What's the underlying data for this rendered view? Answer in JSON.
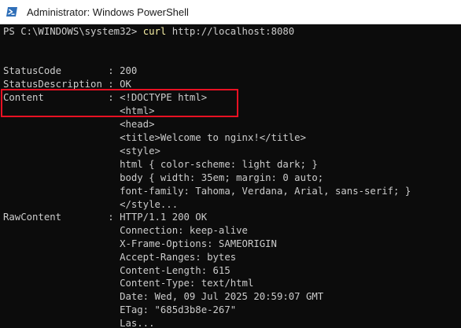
{
  "window": {
    "title": "Administrator: Windows PowerShell",
    "icon": "powershell-icon"
  },
  "terminal": {
    "prompt": "PS C:\\WINDOWS\\system32> ",
    "command": "curl",
    "command_args": " http://localhost:8080",
    "lines": [
      "StatusCode        : 200",
      "StatusDescription : OK",
      "Content           : <!DOCTYPE html>",
      "                    <html>",
      "                    <head>",
      "                    <title>Welcome to nginx!</title>",
      "                    <style>",
      "                    html { color-scheme: light dark; }",
      "                    body { width: 35em; margin: 0 auto;",
      "                    font-family: Tahoma, Verdana, Arial, sans-serif; }",
      "                    </style...",
      "RawContent        : HTTP/1.1 200 OK",
      "                    Connection: keep-alive",
      "                    X-Frame-Options: SAMEORIGIN",
      "                    Accept-Ranges: bytes",
      "                    Content-Length: 615",
      "                    Content-Type: text/html",
      "                    Date: Wed, 09 Jul 2025 20:59:07 GMT",
      "                    ETag: \"685d3b8e-267\"",
      "                    Las..."
    ]
  },
  "colors": {
    "terminal_background": "#0c0c0c",
    "terminal_text": "#cccccc",
    "command_text": "#f9f1a5",
    "highlight_border": "#e81123"
  }
}
